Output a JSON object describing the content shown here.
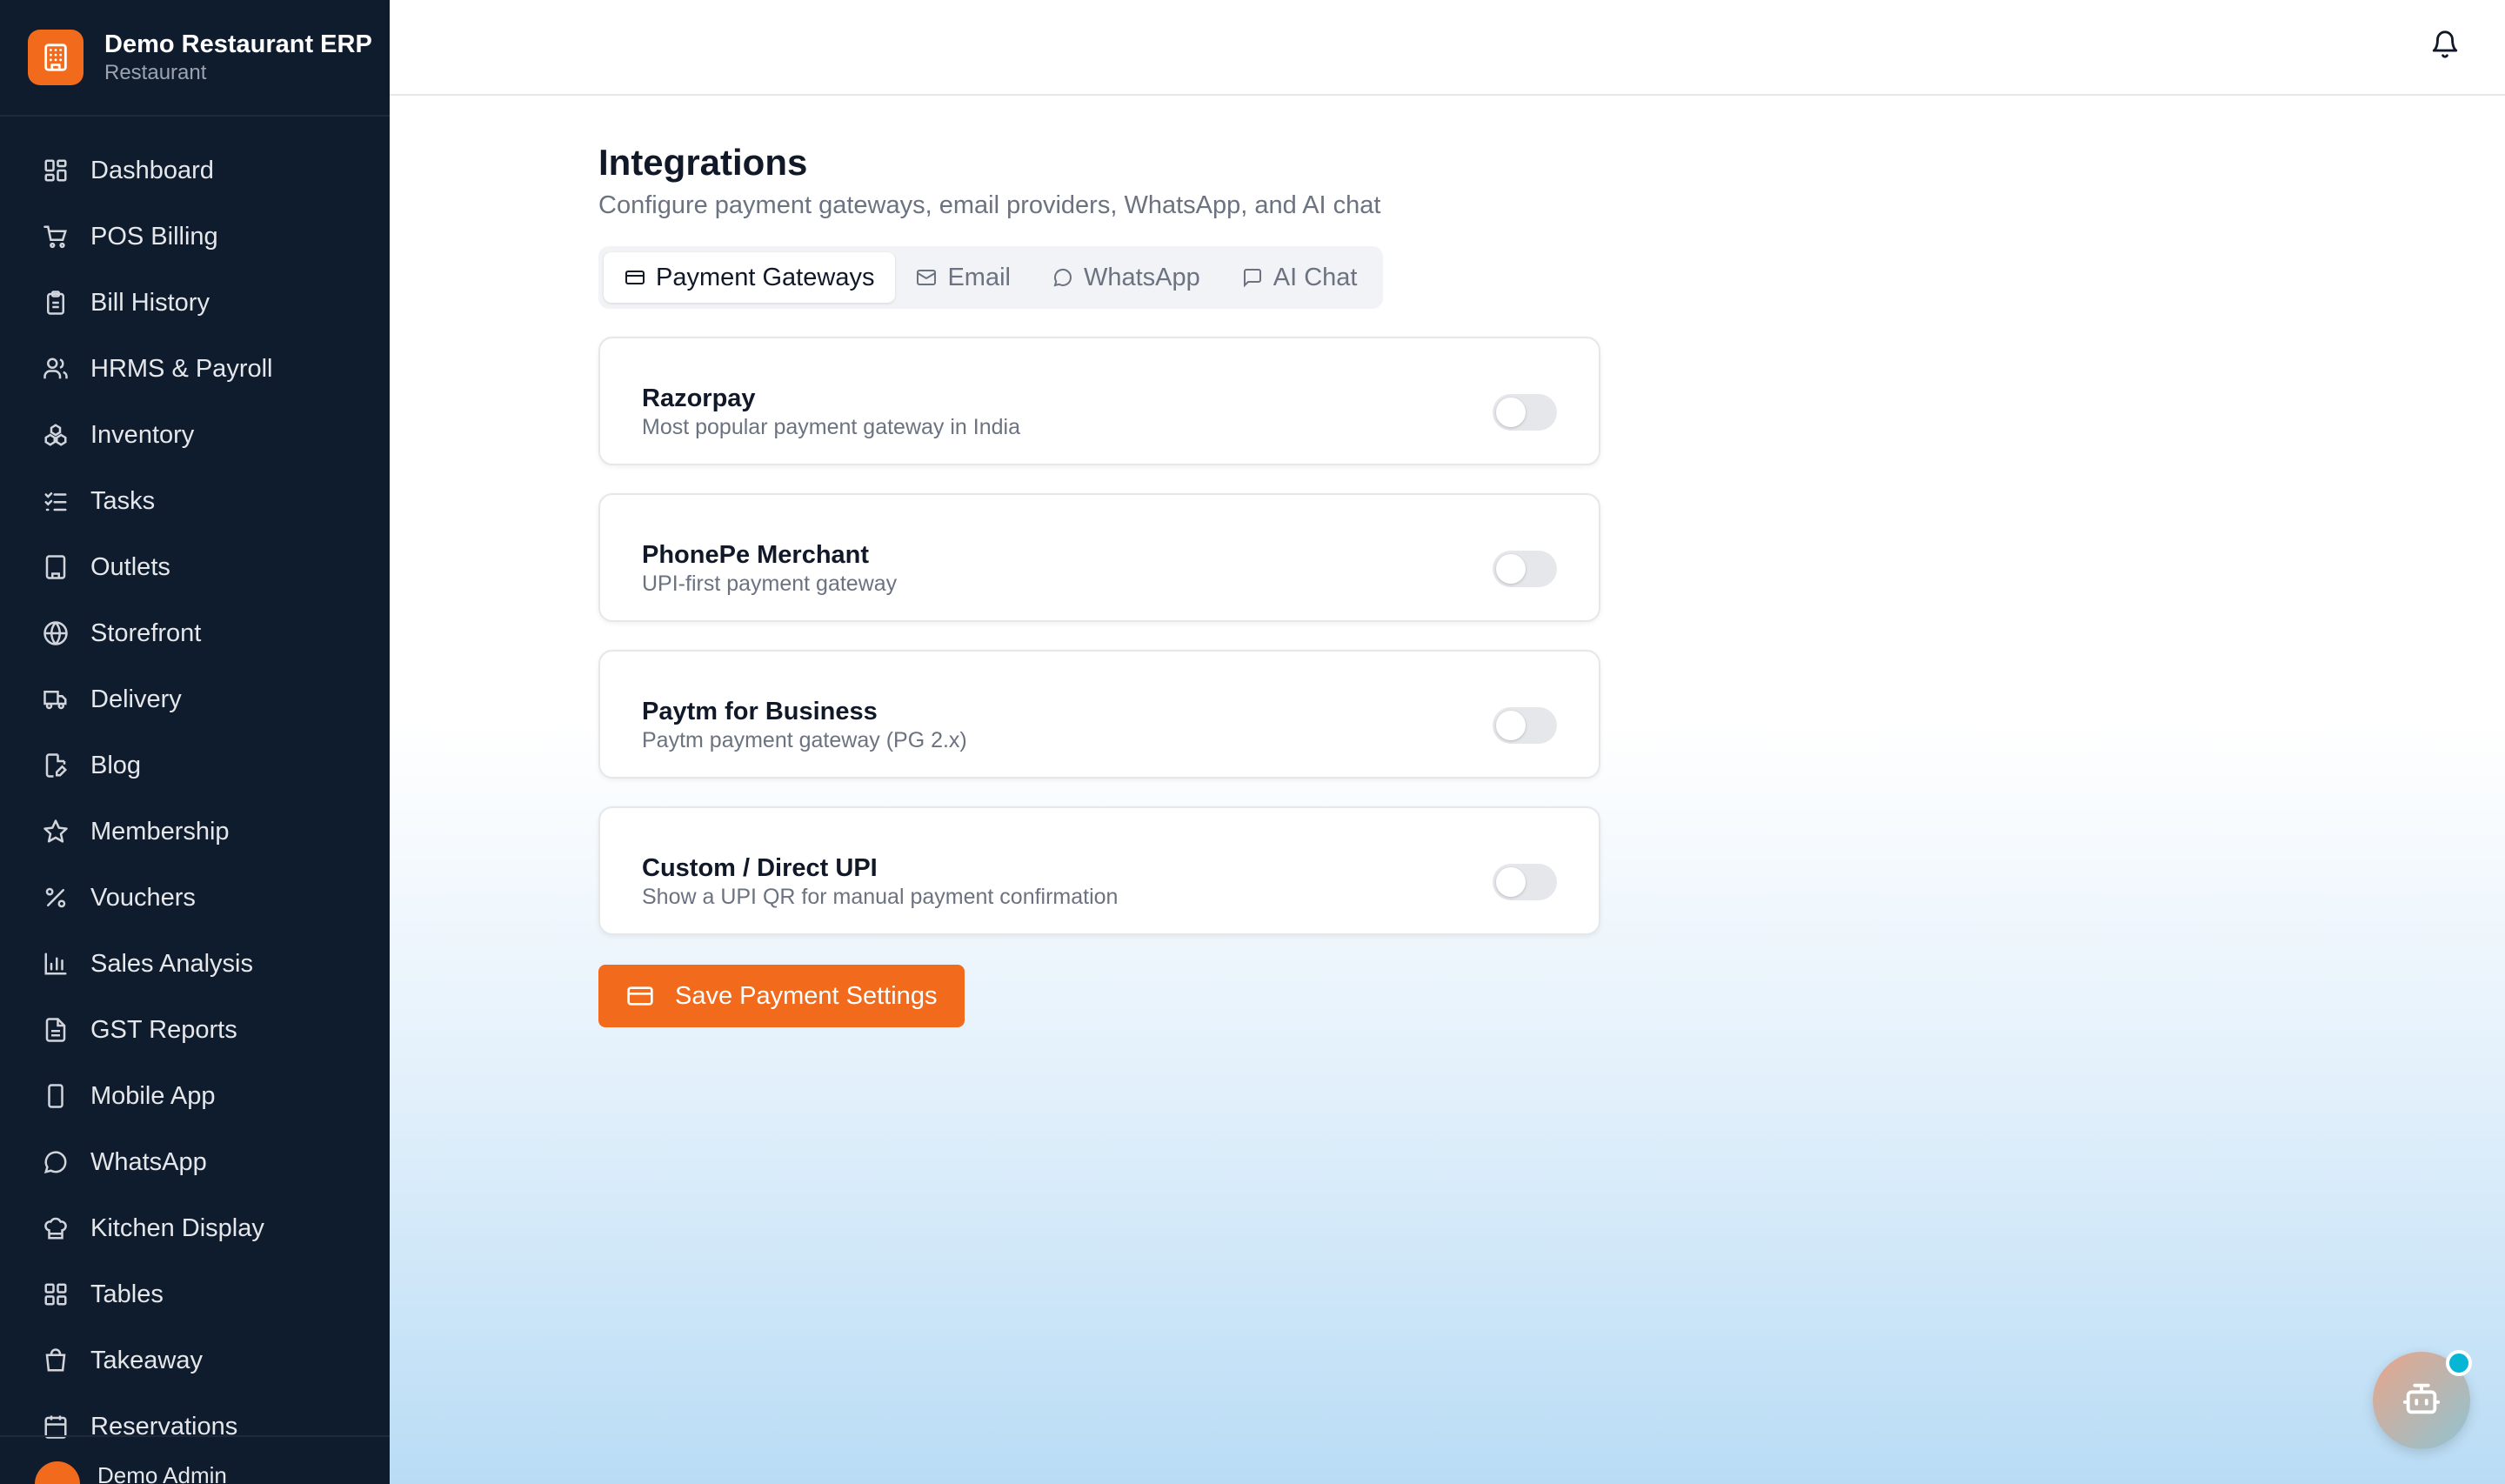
{
  "brand": {
    "title": "Demo Restaurant ERP",
    "subtitle": "Restaurant",
    "accent": "#f26a1b"
  },
  "sidebar": {
    "items": [
      {
        "label": "Dashboard",
        "icon": "grid-icon"
      },
      {
        "label": "POS Billing",
        "icon": "cart-icon"
      },
      {
        "label": "Bill History",
        "icon": "clipboard-icon"
      },
      {
        "label": "HRMS & Payroll",
        "icon": "users-icon"
      },
      {
        "label": "Inventory",
        "icon": "boxes-icon"
      },
      {
        "label": "Tasks",
        "icon": "checklist-icon"
      },
      {
        "label": "Outlets",
        "icon": "building-icon"
      },
      {
        "label": "Storefront",
        "icon": "globe-icon"
      },
      {
        "label": "Delivery",
        "icon": "truck-icon"
      },
      {
        "label": "Blog",
        "icon": "file-pen-icon"
      },
      {
        "label": "Membership",
        "icon": "star-icon"
      },
      {
        "label": "Vouchers",
        "icon": "percent-icon"
      },
      {
        "label": "Sales Analysis",
        "icon": "bar-chart-icon"
      },
      {
        "label": "GST Reports",
        "icon": "file-text-icon"
      },
      {
        "label": "Mobile App",
        "icon": "smartphone-icon"
      },
      {
        "label": "WhatsApp",
        "icon": "message-circle-icon"
      },
      {
        "label": "Kitchen Display",
        "icon": "chef-hat-icon"
      },
      {
        "label": "Tables",
        "icon": "grid-icon"
      },
      {
        "label": "Takeaway",
        "icon": "shopping-bag-icon"
      },
      {
        "label": "Reservations",
        "icon": "calendar-icon"
      }
    ],
    "user": {
      "name": "Demo Admin"
    }
  },
  "header": {
    "notification_icon": "bell-icon"
  },
  "page": {
    "title": "Integrations",
    "subtitle": "Configure payment gateways, email providers, WhatsApp, and AI chat"
  },
  "tabs": [
    {
      "label": "Payment Gateways",
      "icon": "credit-card-icon",
      "active": true
    },
    {
      "label": "Email",
      "icon": "mail-icon",
      "active": false
    },
    {
      "label": "WhatsApp",
      "icon": "message-circle-icon",
      "active": false
    },
    {
      "label": "AI Chat",
      "icon": "message-square-icon",
      "active": false
    }
  ],
  "gateways": [
    {
      "name": "Razorpay",
      "description": "Most popular payment gateway in India",
      "enabled": false
    },
    {
      "name": "PhonePe Merchant",
      "description": "UPI-first payment gateway",
      "enabled": false
    },
    {
      "name": "Paytm for Business",
      "description": "Paytm payment gateway (PG 2.x)",
      "enabled": false
    },
    {
      "name": "Custom / Direct UPI",
      "description": "Show a UPI QR for manual payment confirmation",
      "enabled": false
    }
  ],
  "actions": {
    "save_label": "Save Payment Settings"
  },
  "chat_widget": {
    "icon": "bot-icon",
    "status_color": "#06b6d4"
  }
}
